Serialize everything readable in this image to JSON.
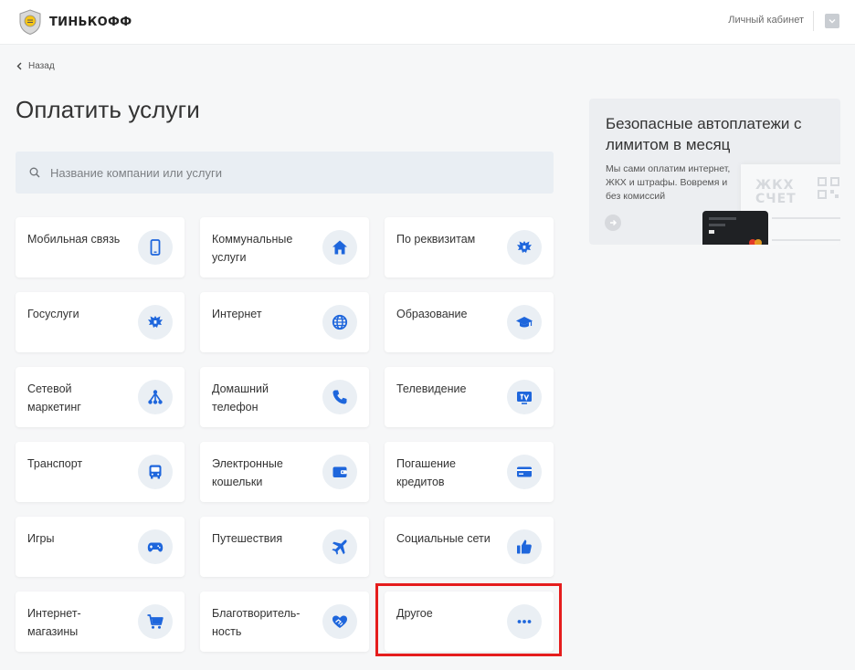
{
  "header": {
    "brand": "ТИНЬКОФФ",
    "account_link": "Личный кабинет"
  },
  "nav": {
    "back_label": "Назад"
  },
  "page": {
    "title": "Оплатить услуги"
  },
  "search": {
    "value": "",
    "placeholder": "Название компании или услуги"
  },
  "services": [
    {
      "label": "Мобильная связь",
      "icon": "mobile-phone-icon"
    },
    {
      "label": "Коммунальные\nуслуги",
      "icon": "house-icon"
    },
    {
      "label": "По реквизитам",
      "icon": "coat-of-arms-icon"
    },
    {
      "label": "Госуслуги",
      "icon": "coat-of-arms-icon"
    },
    {
      "label": "Интернет",
      "icon": "globe-icon"
    },
    {
      "label": "Образование",
      "icon": "graduation-cap-icon"
    },
    {
      "label": "Сетевой\nмаркетинг",
      "icon": "network-icon"
    },
    {
      "label": "Домашний\nтелефон",
      "icon": "phone-handset-icon"
    },
    {
      "label": "Телевидение",
      "icon": "tv-icon"
    },
    {
      "label": "Транспорт",
      "icon": "bus-icon"
    },
    {
      "label": "Электронные\nкошельки",
      "icon": "wallet-icon"
    },
    {
      "label": "Погашение\nкредитов",
      "icon": "credit-card-icon"
    },
    {
      "label": "Игры",
      "icon": "gamepad-icon"
    },
    {
      "label": "Путешествия",
      "icon": "airplane-icon"
    },
    {
      "label": "Социальные сети",
      "icon": "thumbs-up-icon"
    },
    {
      "label": "Интернет-\nмагазины",
      "icon": "shopping-cart-icon"
    },
    {
      "label": "Благотворитель-\nность",
      "icon": "handshake-heart-icon"
    },
    {
      "label": "Другое",
      "icon": "more-dots-icon"
    }
  ],
  "promo": {
    "title": "Безопасные автоплатежи с лимитом в месяц",
    "text": "Мы сами оплатим интернет, ЖКХ и штрафы. Вовремя и без комиссий",
    "receipt_text": "ЖКХ\nСЧЕТ"
  },
  "colors": {
    "accent": "#1e66dc",
    "icon_bg": "#eaeff4",
    "highlight": "#e51d1d",
    "brand_yellow": "#f5c518"
  }
}
